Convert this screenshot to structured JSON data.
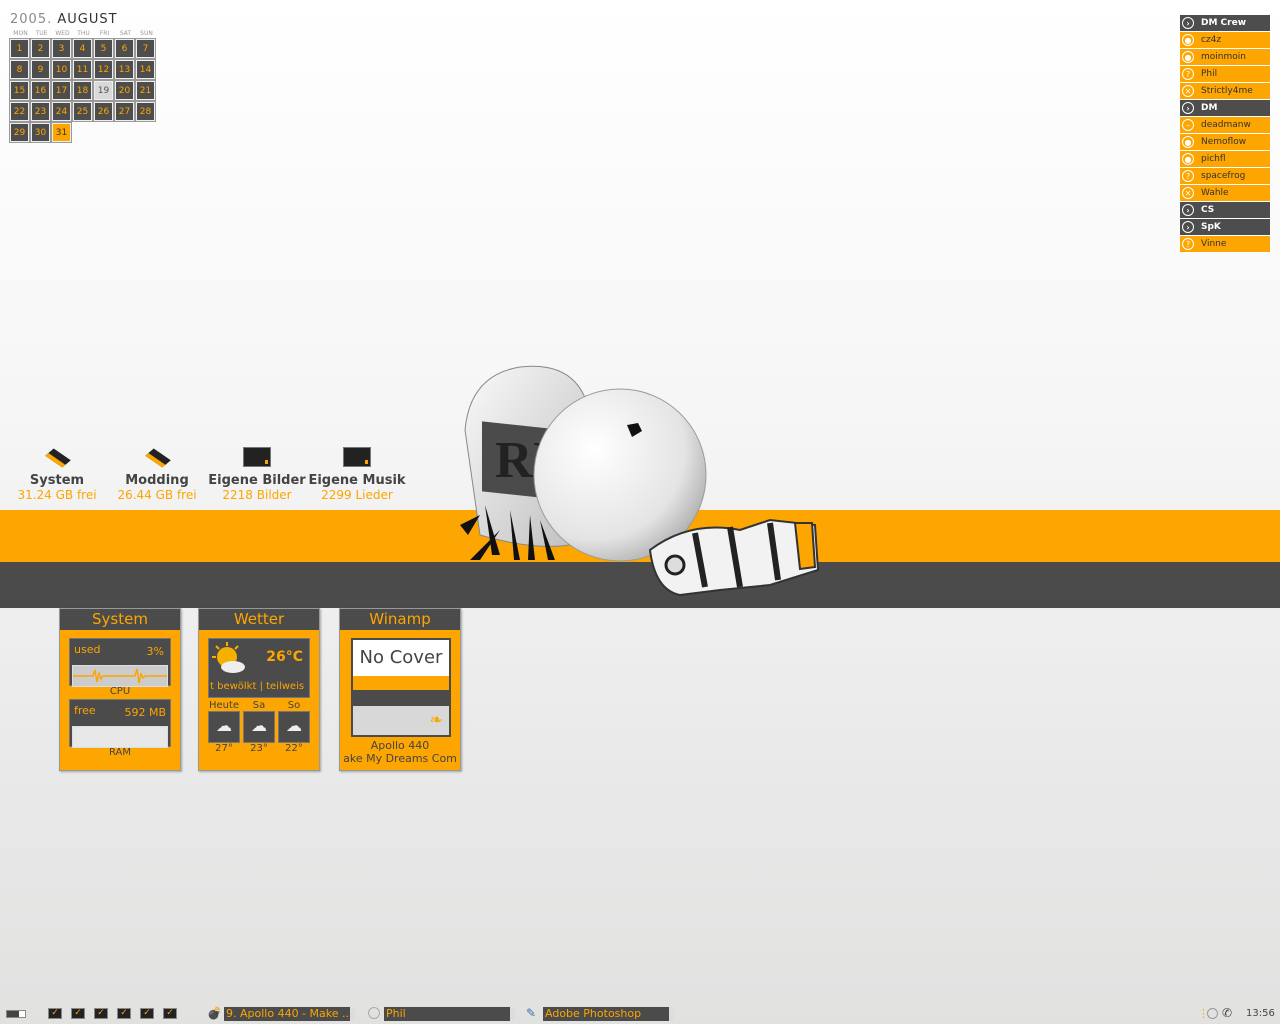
{
  "calendar": {
    "year": "2005",
    "month": "AUGUST",
    "weekdays": [
      "MON",
      "TUE",
      "WED",
      "THU",
      "FRI",
      "SAT",
      "SUN"
    ],
    "days": [
      "1",
      "2",
      "3",
      "4",
      "5",
      "6",
      "7",
      "8",
      "9",
      "10",
      "11",
      "12",
      "13",
      "14",
      "15",
      "16",
      "17",
      "18",
      "19",
      "20",
      "21",
      "22",
      "23",
      "24",
      "25",
      "26",
      "27",
      "28",
      "29",
      "30",
      "31"
    ],
    "today": "19",
    "highlighted": "31"
  },
  "buddies": {
    "groups": [
      {
        "name": "DM Crew",
        "members": [
          {
            "name": "cz4z",
            "icon": "online-icon"
          },
          {
            "name": "moinmoin",
            "icon": "online-icon"
          },
          {
            "name": "Phil",
            "icon": "away-icon"
          },
          {
            "name": "Strictly4me",
            "icon": "busy-icon"
          }
        ]
      },
      {
        "name": "DM",
        "members": [
          {
            "name": "deadmanw",
            "icon": "dnd-icon"
          },
          {
            "name": "Nemoflow",
            "icon": "online-icon"
          },
          {
            "name": "pichfl",
            "icon": "online-icon"
          },
          {
            "name": "spacefrog",
            "icon": "away-icon"
          },
          {
            "name": "Wahle",
            "icon": "busy-icon"
          }
        ]
      },
      {
        "name": "CS",
        "members": []
      },
      {
        "name": "SpK",
        "members": [
          {
            "name": "Vinne",
            "icon": "away-icon"
          }
        ]
      }
    ]
  },
  "drives": [
    {
      "name": "System",
      "value": "31.24 GB frei",
      "icon": "hard-drive-icon"
    },
    {
      "name": "Modding",
      "value": "26.44 GB frei",
      "icon": "hard-drive-icon"
    },
    {
      "name": "Eigene Bilder",
      "value": "2218 Bilder",
      "icon": "folder-icon"
    },
    {
      "name": "Eigene Musik",
      "value": "2299 Lieder",
      "icon": "folder-icon"
    }
  ],
  "wallpaper": {
    "tombstone_text": "RIP"
  },
  "system_widget": {
    "title": "System",
    "cpu_used_label": "used",
    "cpu_used_value": "3%",
    "cpu_caption": "CPU",
    "ram_free_label": "free",
    "ram_free_value": "592 MB",
    "ram_caption": "RAM"
  },
  "weather_widget": {
    "title": "Wetter",
    "temperature": "26°C",
    "condition": "t bewölkt | teilweis",
    "forecast": [
      {
        "day": "Heute",
        "temp": "27°",
        "icon": "thunderstorm-icon"
      },
      {
        "day": "Sa",
        "temp": "23°",
        "icon": "snow-cloud-icon"
      },
      {
        "day": "So",
        "temp": "22°",
        "icon": "cloud-icon"
      }
    ]
  },
  "winamp_widget": {
    "title": "Winamp",
    "cover_text": "No Cover",
    "artist": "Apollo 440",
    "track": "ake My Dreams Com"
  },
  "taskbar": {
    "tasks": [
      {
        "label": "9. Apollo 440 - Make ...",
        "icon": "winamp-icon"
      },
      {
        "label": "Phil",
        "icon": "miranda-icon"
      },
      {
        "label": "Adobe Photoshop",
        "icon": "photoshop-icon"
      }
    ],
    "clock": "13:56"
  },
  "colors": {
    "accent": "#fda500",
    "dark": "#4b4b4b"
  }
}
